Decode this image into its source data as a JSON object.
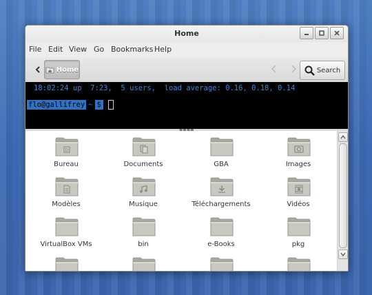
{
  "window": {
    "title": "Home"
  },
  "menubar": {
    "items": [
      "File",
      "Edit",
      "View",
      "Go",
      "Bookmarks",
      "Help"
    ]
  },
  "toolbar": {
    "crumb_label": "Home",
    "crumb_icon": "home-folder-icon",
    "search_label": "Search"
  },
  "terminal": {
    "status_line": "18:02:24 up  7:23,  5 users,  load average: 0.16, 0.18, 0.14",
    "prompt_user": "flo@gallifrey",
    "prompt_dir": "~",
    "prompt_symbol": "$"
  },
  "files": [
    {
      "name": "Bureau",
      "icon": "desktop-folder-icon"
    },
    {
      "name": "Documents",
      "icon": "documents-folder-icon"
    },
    {
      "name": "GBA",
      "icon": "folder-icon"
    },
    {
      "name": "Images",
      "icon": "pictures-folder-icon"
    },
    {
      "name": "Modèles",
      "icon": "templates-folder-icon"
    },
    {
      "name": "Musique",
      "icon": "music-folder-icon"
    },
    {
      "name": "Téléchargements",
      "icon": "downloads-folder-icon"
    },
    {
      "name": "Vidéos",
      "icon": "videos-folder-icon"
    },
    {
      "name": "VirtualBox VMs",
      "icon": "folder-icon"
    },
    {
      "name": "bin",
      "icon": "folder-icon"
    },
    {
      "name": "e-Books",
      "icon": "folder-icon"
    },
    {
      "name": "pkg",
      "icon": "folder-icon"
    },
    {
      "name": "",
      "icon": "folder-icon"
    },
    {
      "name": "",
      "icon": "folder-icon"
    },
    {
      "name": "",
      "icon": "folder-icon"
    },
    {
      "name": "",
      "icon": "folder-icon"
    }
  ],
  "colors": {
    "desktop": "#3d6ab4",
    "terminal_bg": "#000000",
    "terminal_accent": "#2f72c4",
    "folder": "#bdbdb5"
  }
}
